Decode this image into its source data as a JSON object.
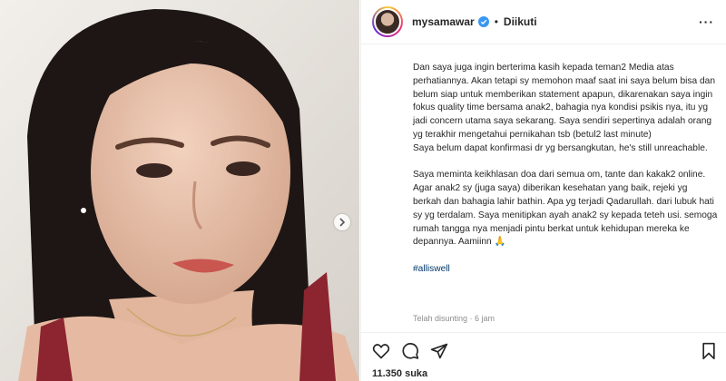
{
  "post": {
    "username": "mysamawar",
    "follow_label": "Diikuti",
    "more_label": "···",
    "caption_paragraphs": [
      "Dan saya juga ingin berterima kasih kepada teman2 Media atas perhatiannya. Akan tetapi sy memohon maaf saat ini saya belum bisa dan belum siap untuk memberikan statement apapun, dikarenakan saya ingin fokus quality time bersama anak2, bahagia nya kondisi psikis nya, itu yg jadi concern utama saya sekarang. Saya sendiri sepertinya adalah orang yg terakhir mengetahui pernikahan tsb (betul2 last minute)\nSaya belum dapat konfirmasi dr yg bersangkutan, he's still unreachable.",
      "Saya meminta keikhlasan doa dari semua om, tante dan kakak2 online. Agar anak2 sy (juga saya) diberikan kesehatan yang baik, rejeki yg berkah dan bahagia lahir bathin. Apa yg terjadi Qadarullah. dari lubuk hati sy yg terdalam. Saya menitipkan ayah anak2 sy kepada teteh usi. semoga rumah tangga nya menjadi pintu berkat untuk kehidupan mereka ke depannya. Aamiinn 🙏"
    ],
    "hashtag": "#alliswell",
    "timestamp": "Telah disunting · 6 jam",
    "likes": "11.350 suka"
  },
  "colors": {
    "text": "#262626",
    "muted": "#8e8e8e",
    "link": "#00376b",
    "verified": "#3897f0"
  }
}
